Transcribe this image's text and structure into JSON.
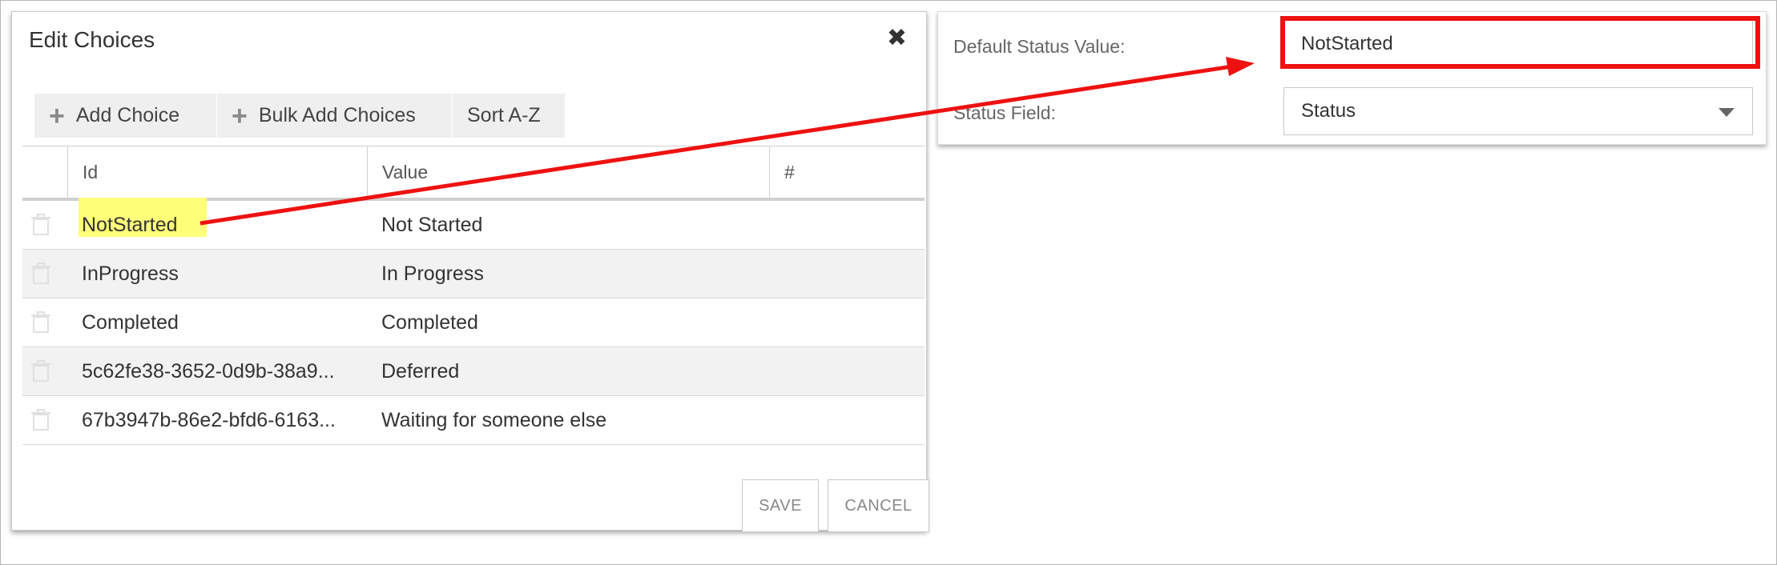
{
  "dialog": {
    "title": "Edit Choices",
    "toolbar": {
      "add_choice": "Add Choice",
      "bulk_add": "Bulk Add Choices",
      "sort": "Sort A-Z"
    },
    "columns": {
      "id": "Id",
      "value": "Value",
      "order": "#"
    },
    "rows": [
      {
        "id": "NotStarted",
        "value": "Not Started"
      },
      {
        "id": "InProgress",
        "value": "In Progress"
      },
      {
        "id": "Completed",
        "value": "Completed"
      },
      {
        "id": "5c62fe38-3652-0d9b-38a9...",
        "value": "Deferred"
      },
      {
        "id": "67b3947b-86e2-bfd6-6163...",
        "value": "Waiting for someone else"
      }
    ],
    "footer": {
      "save": "SAVE",
      "cancel": "CANCEL"
    }
  },
  "panel": {
    "default_status_label": "Default Status Value:",
    "default_status_value": "NotStarted",
    "status_field_label": "Status Field:",
    "status_field_value": "Status"
  },
  "colors": {
    "highlight": "#ffff7a",
    "annotation_red": "#ee1111"
  },
  "icons": {
    "close": "close-icon",
    "add": "plus-icon",
    "delete": "trash-icon",
    "dropdown": "caret-down-icon"
  }
}
